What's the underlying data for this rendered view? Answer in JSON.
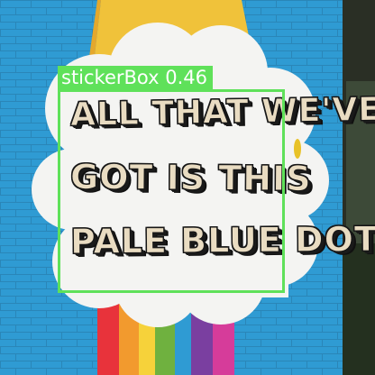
{
  "mural": {
    "line1": "ALL THAT WE'VE",
    "line2": "GOT IS THIS",
    "line3": "PALE BLUE DOT"
  },
  "detection": {
    "label": "stickerBox",
    "score": "0.46",
    "box_color": "#5fe15a"
  },
  "colors": {
    "wall_blue": "#2f9bd3",
    "cloud_white": "#f4f4f2",
    "sun_yellow": "#f0c23a",
    "rainbow": [
      "#e8333b",
      "#f29a2e",
      "#f6d23a",
      "#6fb13f",
      "#7a3fa0",
      "#d63c9a"
    ]
  }
}
